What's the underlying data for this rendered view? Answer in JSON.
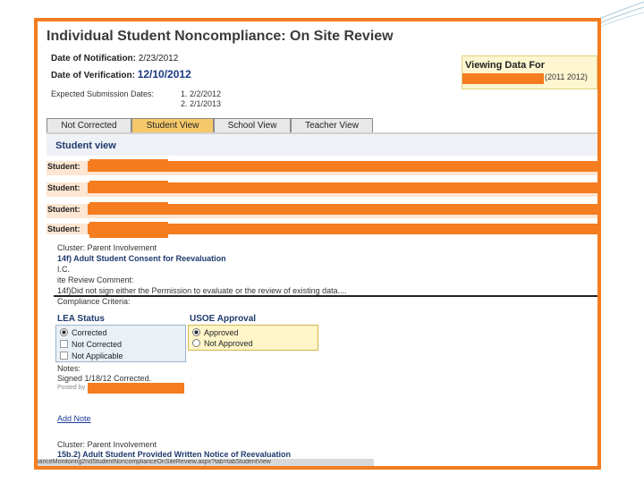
{
  "page": {
    "title": "Individual Student Noncompliance: On Site Review"
  },
  "dates": {
    "notification_label": "Date of Notification:",
    "notification_value": "2/23/2012",
    "verification_label": "Date of Verification:",
    "verification_value": "12/10/2012",
    "expected_label": "Expected Submission Dates:",
    "expected_1": "1. 2/2/2012",
    "expected_2": "2. 2/1/2013"
  },
  "viewing": {
    "title": "Viewing Data For",
    "year": "(2011 2012)"
  },
  "tabs": [
    "Not Corrected",
    "Student View",
    "School View",
    "Teacher View"
  ],
  "active_tab": "Student View",
  "section": {
    "heading": "Student view"
  },
  "students": [
    "Student:",
    "Student:",
    "Student:",
    "Student:"
  ],
  "item1": {
    "cluster": "Cluster: Parent Involvement",
    "title": "14f) Adult Student Consent for Reevaluation",
    "id": "I.C.",
    "comment_label": "ite Review Comment:",
    "comment": "14f)Did not sign either the Permission to evaluate or the review of existing data....",
    "criteria_label": "Compliance Criteria:"
  },
  "lea": {
    "title": "LEA Status",
    "options": [
      "Corrected",
      "Not Corrected",
      "Not Applicable"
    ],
    "selected": "Corrected"
  },
  "usoe": {
    "title": "USOE Approval",
    "options": [
      "Approved",
      "Not Approved"
    ],
    "selected": "Approved"
  },
  "notes": {
    "label": "Notes:",
    "text": "Signed 1/18/12 Corrected.",
    "posted": "Posted by"
  },
  "add_note": "Add Note",
  "item2": {
    "cluster": "Cluster: Parent Involvement",
    "title": "15b.2) Adult Student Provided Written Notice of Reevaluation"
  },
  "status_url": "ianceMonitoring2ndStudentNoncomplianceOnSiteReview.aspx?tab=tabStudentView",
  "colors": {
    "accent": "#f57c1f",
    "heading": "#1f3a6e"
  }
}
